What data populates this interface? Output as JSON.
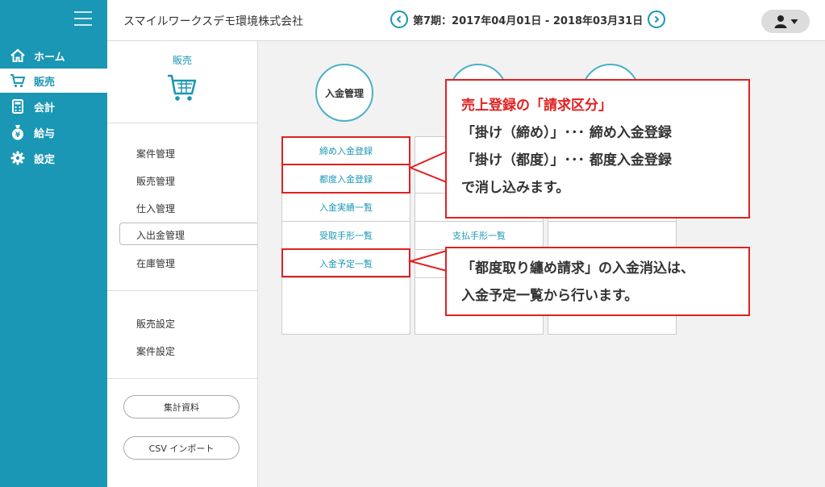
{
  "sidebar": {
    "items": [
      {
        "label": "ホーム",
        "icon": "home-icon"
      },
      {
        "label": "販売",
        "icon": "cart-icon"
      },
      {
        "label": "会計",
        "icon": "calculator-icon"
      },
      {
        "label": "給与",
        "icon": "money-bag-icon"
      },
      {
        "label": "設定",
        "icon": "gear-icon"
      }
    ]
  },
  "header": {
    "company": "スマイルワークスデモ環境株式会社",
    "period": "第7期：2017年04月01日 - 2018年03月31日"
  },
  "subnav": {
    "title": "販売",
    "items": [
      "案件管理",
      "販売管理",
      "仕入管理",
      "入出金管理",
      "在庫管理"
    ],
    "settings": [
      "販売設定",
      "案件設定"
    ],
    "buttons": [
      "集計資料",
      "CSV インポート"
    ]
  },
  "main": {
    "circle_title": "入金管理",
    "col1": [
      "締め入金登録",
      "都度入金登録",
      "入金実績一覧",
      "受取手形一覧",
      "入金予定一覧"
    ],
    "col2_item": "支払手形一覧"
  },
  "callouts": {
    "box1": [
      "売上登録の「請求区分」",
      "「掛け（締め）」･･･ 締め入金登録",
      "「掛け（都度）」･･･ 都度入金登録",
      "で消し込みます。"
    ],
    "box2": [
      "「都度取り纏め請求」の入金消込は、",
      "入金予定一覧から行います。"
    ]
  },
  "colors": {
    "accent": "#1a97b4",
    "annotation": "#e02020"
  }
}
